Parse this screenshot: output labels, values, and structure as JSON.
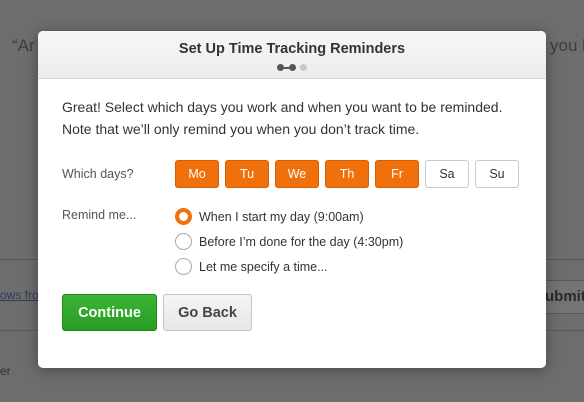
{
  "background": {
    "quote_left": "“Ar",
    "quote_right": "you h",
    "link_text": "ows fro",
    "submit_label": "ubmit",
    "footer_text": "er"
  },
  "modal": {
    "title": "Set Up Time Tracking Reminders",
    "steps": {
      "total": 3,
      "current": 2
    },
    "intro": "Great! Select which days you work and when you want to be reminded. Note that we’ll only remind you when you don’t track time.",
    "days_label": "Which days?",
    "days": [
      {
        "label": "Mo",
        "selected": true
      },
      {
        "label": "Tu",
        "selected": true
      },
      {
        "label": "We",
        "selected": true
      },
      {
        "label": "Th",
        "selected": true
      },
      {
        "label": "Fr",
        "selected": true
      },
      {
        "label": "Sa",
        "selected": false
      },
      {
        "label": "Su",
        "selected": false
      }
    ],
    "remind_label": "Remind me...",
    "remind_options": [
      {
        "label": "When I start my day (9:00am)",
        "selected": true
      },
      {
        "label": "Before I’m done for the day (4:30pm)",
        "selected": false
      },
      {
        "label": "Let me specify a time...",
        "selected": false
      }
    ],
    "continue_label": "Continue",
    "back_label": "Go Back"
  },
  "colors": {
    "accent_orange": "#f0700c",
    "primary_green": "#2fa82a",
    "overlay": "#6d6d6d"
  }
}
